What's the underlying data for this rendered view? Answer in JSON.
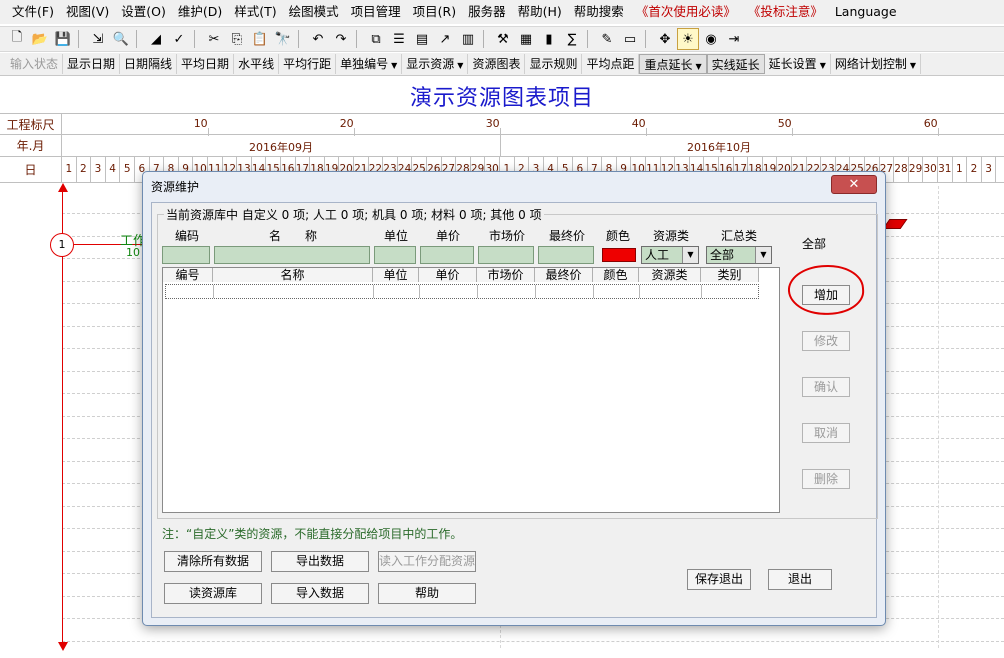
{
  "menu": [
    "文件(F)",
    "视图(V)",
    "设置(O)",
    "维护(D)",
    "样式(T)",
    "绘图模式",
    "项目管理",
    "项目(R)",
    "服务器",
    "帮助(H)",
    "帮助搜索",
    "《首次使用必读》",
    "《投标注意》",
    "Language"
  ],
  "toolbar_icons": [
    "new-icon",
    "open-icon",
    "save-icon",
    "export-icon",
    "print-preview-icon",
    "line-icon",
    "check-icon",
    "cut-icon",
    "copy-icon",
    "paste-icon",
    "find-icon",
    "undo-icon",
    "redo-icon",
    "network-icon",
    "gantt-icon",
    "bar-icon",
    "line-chart-icon",
    "resource-icon",
    "tools-icon",
    "layout-icon",
    "bar-chart-icon",
    "calc-icon",
    "edit-icon",
    "screen-icon",
    "pin-icon",
    "bulb-icon",
    "globe-icon",
    "exit-icon"
  ],
  "toolbar2": [
    "输入状态",
    "显示日期",
    "日期隔线",
    "平均日期",
    "水平线",
    "平均行距",
    "单独编号",
    "显示资源",
    "资源图表",
    "显示规则",
    "平均点距",
    "重点延长",
    "实线延长",
    "延长设置",
    "网络计划控制"
  ],
  "chart": {
    "title": "演示资源图表项目",
    "row_labels": [
      "工程标尺",
      "年.月",
      "日"
    ],
    "scale_ticks": [
      "10",
      "20",
      "30",
      "40",
      "50",
      "60"
    ],
    "months": [
      "2016年09月",
      "2016年10月"
    ],
    "days": [
      "1",
      "2",
      "3",
      "4",
      "5",
      "6",
      "7",
      "8",
      "9",
      "10",
      "11",
      "12",
      "13",
      "14",
      "15",
      "16",
      "17",
      "18",
      "19",
      "20",
      "21",
      "22",
      "23",
      "24",
      "25",
      "26",
      "27",
      "28",
      "29",
      "30",
      "1",
      "2",
      "3",
      "4",
      "5",
      "6",
      "7",
      "8",
      "9",
      "10",
      "11",
      "12",
      "13",
      "14",
      "15",
      "16",
      "17",
      "18",
      "19",
      "20",
      "21",
      "22",
      "23",
      "24",
      "25",
      "26",
      "27",
      "28",
      "29",
      "30",
      "31",
      "1",
      "2",
      "3"
    ],
    "node_label": "1",
    "work_label": "工作",
    "work_duration": "10"
  },
  "dialog": {
    "title": "资源维护",
    "close": "✕",
    "group_legend": "当前资源库中 自定义 0 项; 人工 0 项; 机具 0 项; 材料 0 项; 其他 0 项",
    "input_headers": [
      "编码",
      "名　　称",
      "单位",
      "单价",
      "市场价",
      "最终价",
      "颜色",
      "资源类",
      "汇总类"
    ],
    "resource_type_value": "人工",
    "summary_type_value": "全部",
    "grid_columns": [
      "编号",
      "名称",
      "单位",
      "单价",
      "市场价",
      "最终价",
      "颜色",
      "资源类",
      "类别"
    ],
    "all_label": "全部",
    "buttons": {
      "add": "增加",
      "modify": "修改",
      "confirm": "确认",
      "cancel": "取消",
      "delete": "删除",
      "clear_all": "清除所有数据",
      "export": "导出数据",
      "read_assign": "读入工作分配资源",
      "read_lib": "读资源库",
      "import": "导入数据",
      "help": "帮助",
      "save_exit": "保存退出",
      "exit": "退出"
    },
    "note": "注：“自定义”类的资源，不能直接分配给项目中的工作。"
  }
}
